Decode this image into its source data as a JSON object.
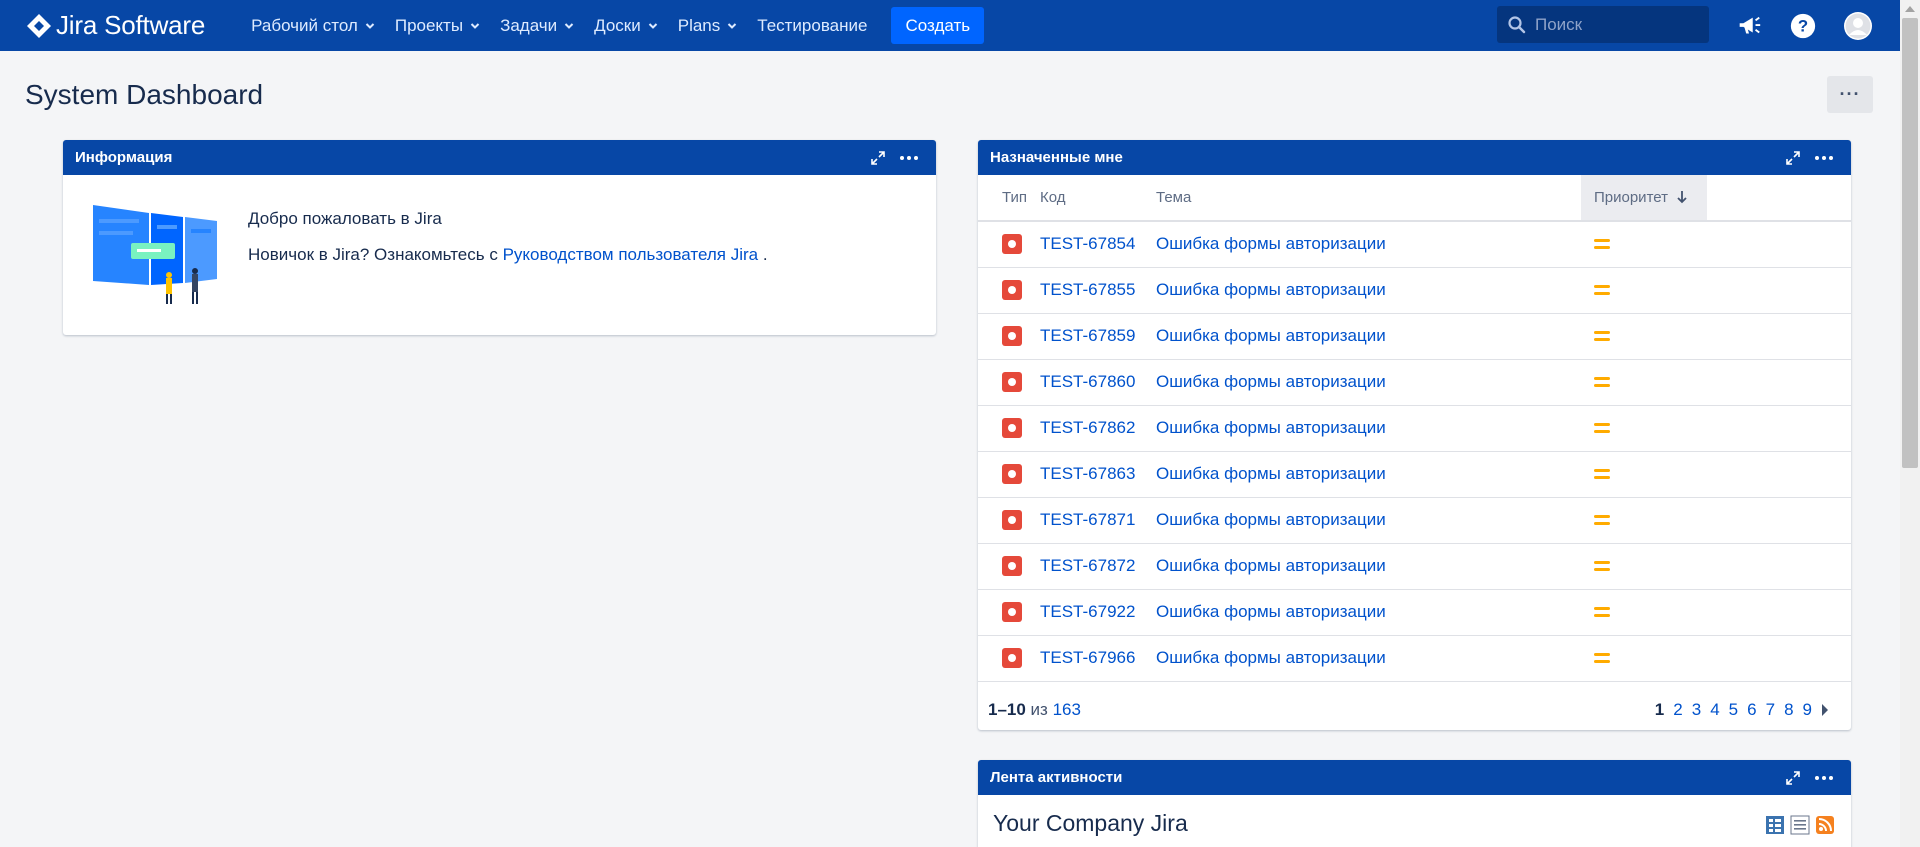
{
  "app": {
    "name": "Jira Software",
    "nav": [
      {
        "label": "Рабочий стол",
        "dropdown": true
      },
      {
        "label": "Проекты",
        "dropdown": true
      },
      {
        "label": "Задачи",
        "dropdown": true
      },
      {
        "label": "Доски",
        "dropdown": true
      },
      {
        "label": "Plans",
        "dropdown": true
      },
      {
        "label": "Тестирование",
        "dropdown": false
      }
    ],
    "create_label": "Создать",
    "search_placeholder": "Поиск",
    "icons": [
      "megaphone-icon",
      "help-icon",
      "avatar"
    ]
  },
  "page": {
    "title": "System Dashboard",
    "tools_label": "···"
  },
  "info_gadget": {
    "title": "Информация",
    "welcome": "Добро пожаловать в Jira",
    "newbie_prefix": "Новичок в Jira? Ознакомьтесь с ",
    "guide_link": "Руководством пользователя Jira",
    "newbie_suffix": " ."
  },
  "assigned_gadget": {
    "title": "Назначенные мне",
    "columns": {
      "type": "Тип",
      "key": "Код",
      "summary": "Тема",
      "priority": "Приоритет"
    },
    "rows": [
      {
        "key": "TEST-67854",
        "summary": "Ошибка формы авторизации"
      },
      {
        "key": "TEST-67855",
        "summary": "Ошибка формы авторизации"
      },
      {
        "key": "TEST-67859",
        "summary": "Ошибка формы авторизации"
      },
      {
        "key": "TEST-67860",
        "summary": "Ошибка формы авторизации"
      },
      {
        "key": "TEST-67862",
        "summary": "Ошибка формы авторизации"
      },
      {
        "key": "TEST-67863",
        "summary": "Ошибка формы авторизации"
      },
      {
        "key": "TEST-67871",
        "summary": "Ошибка формы авторизации"
      },
      {
        "key": "TEST-67872",
        "summary": "Ошибка формы авторизации"
      },
      {
        "key": "TEST-67922",
        "summary": "Ошибка формы авторизации"
      },
      {
        "key": "TEST-67966",
        "summary": "Ошибка формы авторизации"
      }
    ],
    "pager": {
      "range": "1–10",
      "of": " из ",
      "total": "163",
      "pages": [
        "1",
        "2",
        "3",
        "4",
        "5",
        "6",
        "7",
        "8",
        "9"
      ],
      "current": "1"
    }
  },
  "activity_gadget": {
    "title": "Лента активности",
    "stream_title": "Your Company Jira"
  },
  "colors": {
    "nav_bg": "#0747a6",
    "create_bg": "#0065ff",
    "link": "#0052cc",
    "bug": "#e5493a",
    "priority_medium": "#ffab00"
  }
}
